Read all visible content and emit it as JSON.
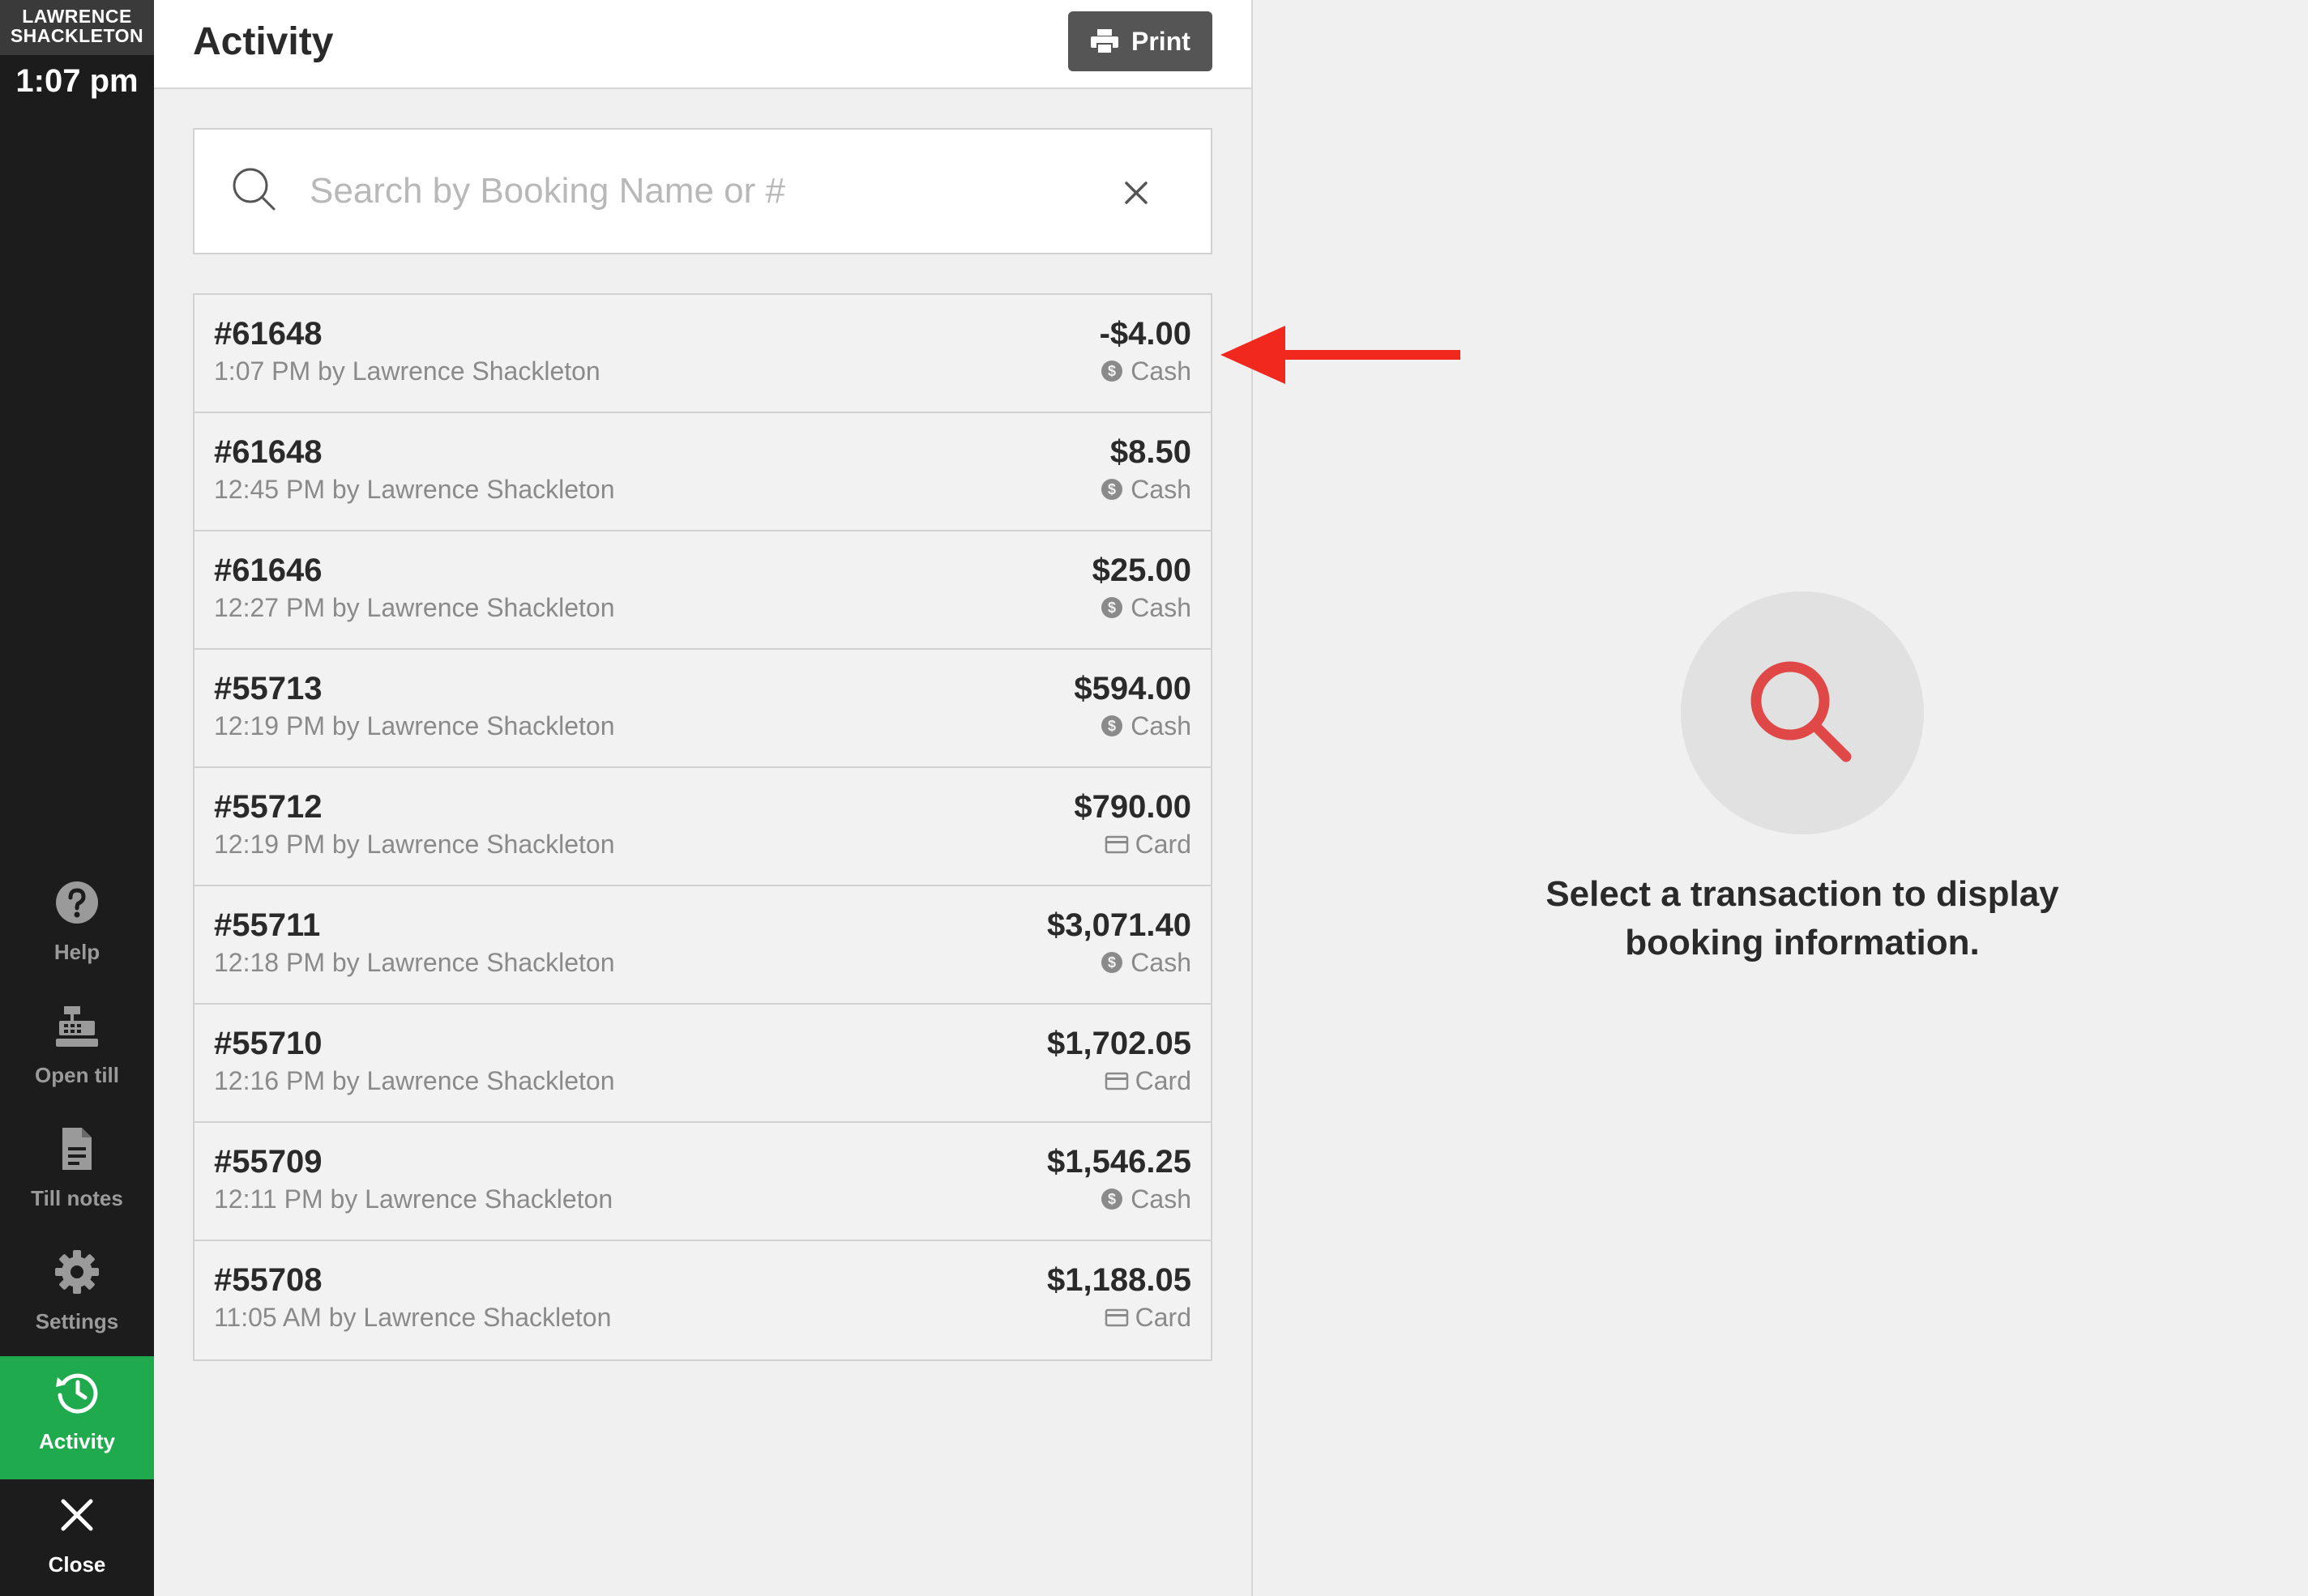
{
  "sidebar": {
    "user_name": "LAWRENCE SHACKLETON",
    "clock": "1:07 pm",
    "nav": {
      "help": "Help",
      "open_till": "Open till",
      "till_notes": "Till notes",
      "settings": "Settings",
      "activity": "Activity",
      "close": "Close"
    }
  },
  "header": {
    "title": "Activity",
    "print_label": "Print"
  },
  "search": {
    "placeholder": "Search by Booking Name or #",
    "value": ""
  },
  "transactions": [
    {
      "number": "#61648",
      "detail": "1:07 PM by Lawrence Shackleton",
      "amount": "-$4.00",
      "method": "Cash",
      "method_icon": "cash-icon"
    },
    {
      "number": "#61648",
      "detail": "12:45 PM by Lawrence Shackleton",
      "amount": "$8.50",
      "method": "Cash",
      "method_icon": "cash-icon"
    },
    {
      "number": "#61646",
      "detail": "12:27 PM by Lawrence Shackleton",
      "amount": "$25.00",
      "method": "Cash",
      "method_icon": "cash-icon"
    },
    {
      "number": "#55713",
      "detail": "12:19 PM by Lawrence Shackleton",
      "amount": "$594.00",
      "method": "Cash",
      "method_icon": "cash-icon"
    },
    {
      "number": "#55712",
      "detail": "12:19 PM by Lawrence Shackleton",
      "amount": "$790.00",
      "method": "Card",
      "method_icon": "card-icon"
    },
    {
      "number": "#55711",
      "detail": "12:18 PM by Lawrence Shackleton",
      "amount": "$3,071.40",
      "method": "Cash",
      "method_icon": "cash-icon"
    },
    {
      "number": "#55710",
      "detail": "12:16 PM by Lawrence Shackleton",
      "amount": "$1,702.05",
      "method": "Card",
      "method_icon": "card-icon"
    },
    {
      "number": "#55709",
      "detail": "12:11 PM by Lawrence Shackleton",
      "amount": "$1,546.25",
      "method": "Cash",
      "method_icon": "cash-icon"
    },
    {
      "number": "#55708",
      "detail": "11:05 AM by Lawrence Shackleton",
      "amount": "$1,188.05",
      "method": "Card",
      "method_icon": "card-icon"
    }
  ],
  "empty_state": {
    "message": "Select a transaction to display booking information."
  },
  "colors": {
    "sidebar_bg": "#1c1c1c",
    "active_green": "#1faa4d",
    "accent_red": "#e04848",
    "annotation_arrow": "#f0281e"
  }
}
